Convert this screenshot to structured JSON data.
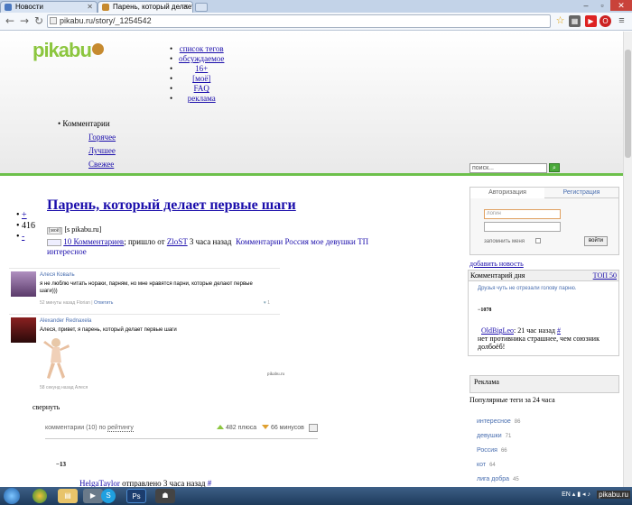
{
  "browser": {
    "tabs": [
      {
        "label": "Новости"
      },
      {
        "label": "Парень, который делает"
      }
    ],
    "url": "pikabu.ru/story/_1254542"
  },
  "header": {
    "logo": "pikabu",
    "nav": [
      "список тегов",
      "обсуждаемое",
      "16+",
      "[моё]",
      "FAQ",
      "реклама"
    ],
    "comments_menu": {
      "label": "Комментарии",
      "items": [
        "Горячее",
        "Лучшее",
        "Свежее"
      ]
    },
    "search_placeholder": "поиск..."
  },
  "post": {
    "title": "Парень, который делает первые шаги",
    "rating": "416",
    "source_tag": "[моё]",
    "source": "[s pikabu.ru]",
    "comments_link": "10 Комментариев",
    "posted_by_prefix": "; пришло от",
    "author": "ZloST",
    "time": "3 часа назад",
    "tags": "Комментарии Россия мое девушки ТП интересное"
  },
  "comments": [
    {
      "name": "Алеся Коваль",
      "text": "я не люблю читать нораки, парням, но мне нравятся парни, которые делают первые шаги)))",
      "time": "52 минуты назад",
      "author": "Florian",
      "reply": "Ответить",
      "likes": "1"
    },
    {
      "name": "Alexander Rednaxela",
      "text": "Алеся, привет, я парень, который делает первые шаги",
      "time": "58 секунд назад",
      "author": "Алеся",
      "watermark": "pikabu.ru"
    }
  ],
  "collapse_label": "свернуть",
  "sort": {
    "label": "комментарии (10) по",
    "by": "рейтингу",
    "plus": "482 плюса",
    "minus": "66 минусов"
  },
  "thread": {
    "score": "−13",
    "user": "HelgaTaylor",
    "text": "отправлено 3 часа назад",
    "hash": "#"
  },
  "sidebar": {
    "auth_tabs": [
      "Авторизация",
      "Регистрация"
    ],
    "login_placeholder": "логин",
    "remember": "запомнить меня",
    "login_button": "войти",
    "add_news": "добавить новость",
    "cotd": {
      "title": "Комментарий дня",
      "top": "ТОП 50",
      "link": "Друзья чуть не отрезали голову парню.",
      "score": "−1078",
      "user": "OldBigLeo",
      "time": "21 час назад",
      "hash": "#",
      "text": "нет противника страшнее, чем союзник долбоёб!"
    },
    "ads_title": "Реклама",
    "tags_title": "Популярные теги за 24 часа",
    "tags": [
      {
        "name": "интересное",
        "count": "86"
      },
      {
        "name": "девушки",
        "count": "71"
      },
      {
        "name": "Россия",
        "count": "66"
      },
      {
        "name": "кот",
        "count": "64"
      },
      {
        "name": "лига добра",
        "count": "45"
      }
    ]
  },
  "taskbar": {
    "lang": "EN",
    "watermark": "pikabu.ru"
  },
  "colors": {
    "brand_green": "#8cc63f",
    "link": "#1a0dab",
    "taskbar": "#2a4a70"
  }
}
